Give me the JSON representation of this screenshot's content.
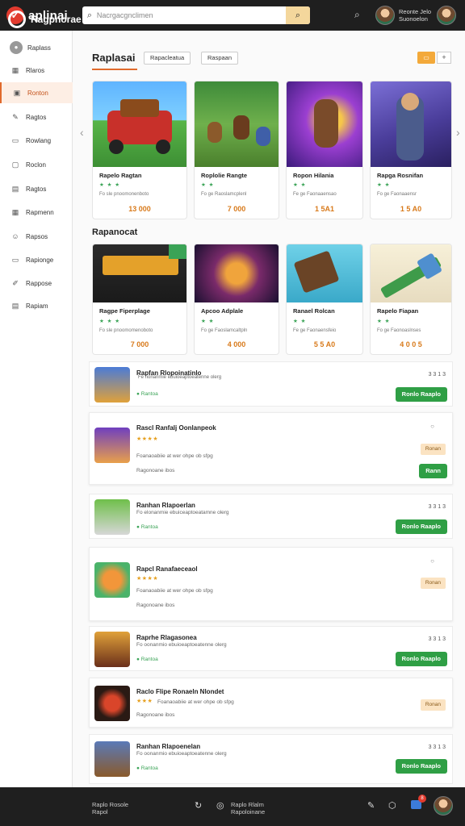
{
  "app": {
    "logo_text": "aplinai"
  },
  "topbar": {
    "search_placeholder": "Nacrgacgnclimen",
    "user_name": "Reonte Jelo",
    "user_sub": "Suonoelon"
  },
  "sidebar": {
    "items": [
      {
        "label": "Raplass",
        "icon": "profile-icon"
      },
      {
        "label": "Rlaros",
        "icon": "grid-icon"
      },
      {
        "label": "Ronton",
        "icon": "game-icon"
      },
      {
        "label": "Ragtos",
        "icon": "pen-icon"
      },
      {
        "label": "Rowlang",
        "icon": "monitor-icon"
      },
      {
        "label": "Roclon",
        "icon": "chat-icon"
      },
      {
        "label": "Ragtos",
        "icon": "book-icon"
      },
      {
        "label": "Rapmenn",
        "icon": "calendar-icon"
      },
      {
        "label": "Rapsos",
        "icon": "users-icon"
      },
      {
        "label": "Rapionge",
        "icon": "tv-icon"
      },
      {
        "label": "Rappose",
        "icon": "pencil-icon"
      },
      {
        "label": "Rapiam",
        "icon": "list-icon"
      }
    ]
  },
  "section1": {
    "title": "Raplasai",
    "chips": [
      "Rapacleatua",
      "Raspaan"
    ],
    "cards": [
      {
        "title": "Rapelo Ragtan",
        "meta": "Fo sle pnoomonenboto",
        "price": "13 000"
      },
      {
        "title": "Roplolie Rangte",
        "meta": "Fo ge Raoslamcplenl",
        "price": "7 000"
      },
      {
        "title": "Ropon Hilania",
        "meta": "Fe ge Faonaaensao",
        "price": "1 5A1"
      },
      {
        "title": "Rapga Rosnifan",
        "meta": "Fo ge Faonaaensr",
        "price": "1 5 A0"
      }
    ]
  },
  "section2": {
    "title": "Rapanocat",
    "cards": [
      {
        "title": "Ragpe Fiperplage",
        "meta": "Fo sle pnoomomenoboto",
        "price": "7 000"
      },
      {
        "title": "Apcoo Adplale",
        "meta": "Fo ge Faoslamcaltpln",
        "price": "4 000"
      },
      {
        "title": "Ranael Rolcan",
        "meta": "Fe ge Faonaensfeio",
        "price": "5 5 A0"
      },
      {
        "title": "Rapelo Fiapan",
        "meta": "Fo ge Faonoaslnses",
        "price": "4 0 0 5"
      }
    ]
  },
  "rows": [
    {
      "title": "Rapfan Rlopoinatinlo",
      "line": "Fe nonanmie ebuioeaptoeatenne olerg",
      "green": "Rantoa",
      "rating": "3 3 1 3",
      "button": "Ronlo Raaplo"
    },
    {
      "title": "Rascl Ranfalj Oonlanpeok",
      "stars": "★★★★",
      "line": "Foanaoabiie at wer ohpe ob sfpg",
      "sub": "Ragonoane ibos",
      "tag": "Ronan",
      "button": "Rann"
    },
    {
      "title": "Ranhan Rlapoerlan",
      "line": "Fo elonanmie ebuiceaptoeatamne olerg",
      "green": "Rantoa",
      "rating": "3 3 1 3",
      "button": "Ronlo Raaplo"
    },
    {
      "title": "Rapcl Ranafaeceaol",
      "stars": "★★★★",
      "line": "Foanaoabiie at wer ohpe ob sfpg",
      "sub": "Ragonoane ibos",
      "tag": "Ronan"
    },
    {
      "title": "Raprhe Rlagasonea",
      "line": "Fo oonanmio ebuioeaptoeatenne olerg",
      "green": "Rantoa",
      "rating": "3 3 1 3",
      "button": "Ronlo Raaplo"
    },
    {
      "title": "Raclo Flipe Ronaeln Nlondet",
      "stars": "★★★",
      "line": "Foanaoabiie at wer ohpe ob sfpg",
      "sub": "Ragonoane ibos",
      "tag": "Ronan"
    },
    {
      "title": "Ranhan Rlapoenelan",
      "line": "Fo oonanmio ebuioeaptoeatenne olerg",
      "green": "Rantoa",
      "rating": "3 3 1 3",
      "button": "Ronlo Raaplo"
    }
  ],
  "bottombar": {
    "name": "Ragpnorae",
    "text1": "Raplo Rosole",
    "text1b": "Rapol",
    "text2": "Raplo Rlalm",
    "text2b": "Rapoloinane",
    "badge": "8"
  }
}
